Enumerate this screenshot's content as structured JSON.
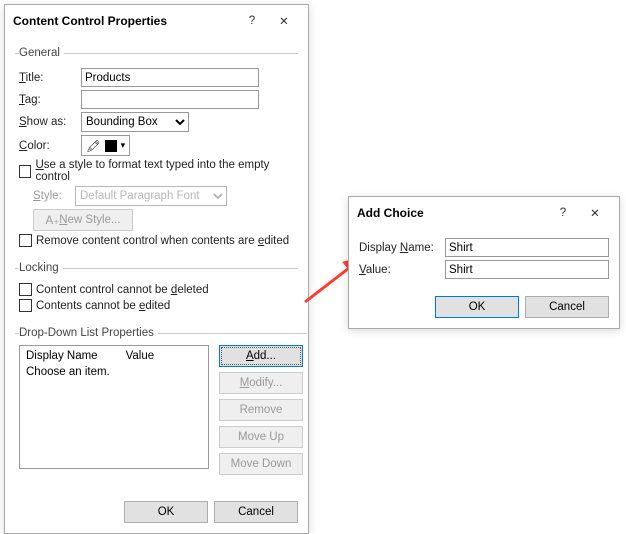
{
  "main_dialog": {
    "title": "Content Control Properties",
    "help": "?",
    "close": "✕",
    "general": {
      "legend": "General",
      "title_label_pre": "T",
      "title_label_post": "itle:",
      "title_value": "Products",
      "tag_label_pre": "T",
      "tag_label_post": "ag:",
      "showas_label_pre": "S",
      "showas_label_post": "how as:",
      "showas_value": "Bounding Box",
      "color_label_pre": "C",
      "color_label_post": "olor:",
      "style_cb_pre": "U",
      "style_cb_post": "se a style to format text typed into the empty control",
      "style_label_pre": "S",
      "style_label_post": "tyle:",
      "style_select": "Default Paragraph Font",
      "new_style_pre": "A₊ ",
      "new_style_u": "N",
      "new_style_post": "ew Style...",
      "remove_cb": "Remove content control when contents are ",
      "remove_cb_u": "e",
      "remove_cb_post": "dited"
    },
    "locking": {
      "legend": "Locking",
      "cb1_pre": "Content control cannot be ",
      "cb1_u": "d",
      "cb1_post": "eleted",
      "cb2_pre": "Contents cannot be ",
      "cb2_u": "e",
      "cb2_post": "dited"
    },
    "dropdown": {
      "legend": "Drop-Down List Properties",
      "col1": "Display Name",
      "col2": "Value",
      "placeholder": "Choose an item.",
      "add_u": "A",
      "add_post": "dd...",
      "modify_u": "M",
      "modify_post": "odify...",
      "remove_label": "Remove",
      "moveup_label": "Move Up",
      "movedown_label": "Move Down"
    },
    "ok": "OK",
    "cancel": "Cancel"
  },
  "add_choice": {
    "title": "Add Choice",
    "help": "?",
    "close": "✕",
    "displayname_label_pre": "Display ",
    "displayname_label_u": "N",
    "displayname_label_post": "ame:",
    "displayname_value": "Shirt",
    "value_label_u": "V",
    "value_label_post": "alue:",
    "value_value": "Shirt",
    "ok": "OK",
    "cancel": "Cancel"
  }
}
